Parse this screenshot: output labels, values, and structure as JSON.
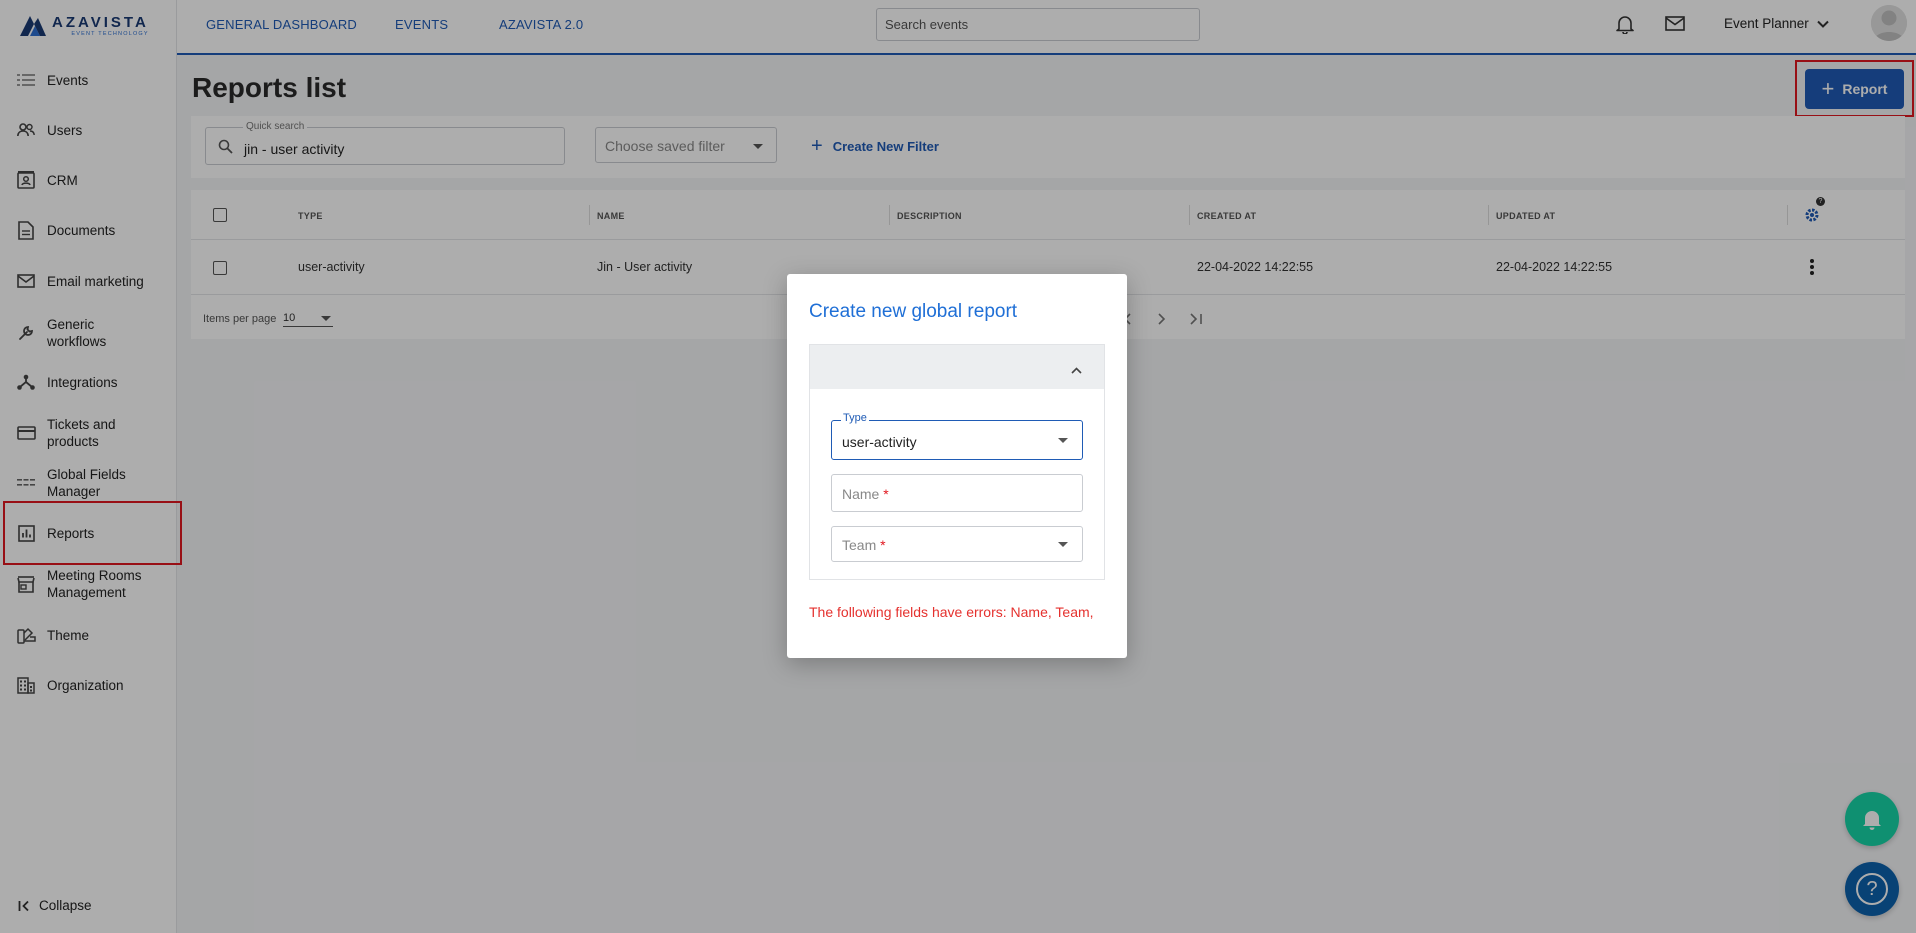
{
  "app": {
    "logo_title": "AZAVISTA",
    "logo_subtitle": "EVENT TECHNOLOGY",
    "accent_color": "#1f5bb5"
  },
  "topbar": {
    "links": [
      "GENERAL DASHBOARD",
      "EVENTS",
      "AZAVISTA 2.0"
    ],
    "search_placeholder": "Search events",
    "user_label": "Event Planner"
  },
  "sidebar": {
    "items": [
      {
        "label": "Events",
        "icon": "events-list-icon"
      },
      {
        "label": "Users",
        "icon": "users-icon"
      },
      {
        "label": "CRM",
        "icon": "crm-icon"
      },
      {
        "label": "Documents",
        "icon": "document-icon"
      },
      {
        "label": "Email marketing",
        "icon": "mail-icon"
      },
      {
        "label": "Generic workflows",
        "icon": "wrench-icon"
      },
      {
        "label": "Integrations",
        "icon": "integrations-icon"
      },
      {
        "label": "Tickets and products",
        "icon": "card-icon"
      },
      {
        "label": "Global Fields Manager",
        "icon": "fields-icon"
      },
      {
        "label": "Reports",
        "icon": "chart-icon"
      },
      {
        "label": "Meeting Rooms Management",
        "icon": "store-icon"
      },
      {
        "label": "Theme",
        "icon": "palette-icon"
      },
      {
        "label": "Organization",
        "icon": "building-icon"
      }
    ],
    "active": "Reports",
    "collapse_label": "Collapse"
  },
  "page": {
    "title": "Reports list",
    "add_button_label": "Report",
    "quick_search_label": "Quick search",
    "quick_search_value": "jin - user activity",
    "saved_filter_placeholder": "Choose saved filter",
    "create_filter_label": "Create New Filter"
  },
  "table": {
    "columns": [
      "TYPE",
      "NAME",
      "DESCRIPTION",
      "CREATED AT",
      "UPDATED AT"
    ],
    "rows": [
      {
        "type": "user-activity",
        "name": "Jin - User activity",
        "description": "",
        "created_at": "22-04-2022 14:22:55",
        "updated_at": "22-04-2022 14:22:55"
      }
    ],
    "items_per_page_label": "Items per page",
    "items_per_page_value": "10",
    "settings_badge": "?"
  },
  "modal": {
    "title": "Create new global report",
    "type_label": "Type",
    "type_value": "user-activity",
    "name_placeholder": "Name",
    "team_placeholder": "Team",
    "required_marker": "*",
    "error_message": "The following fields have errors: Name, Team,"
  }
}
